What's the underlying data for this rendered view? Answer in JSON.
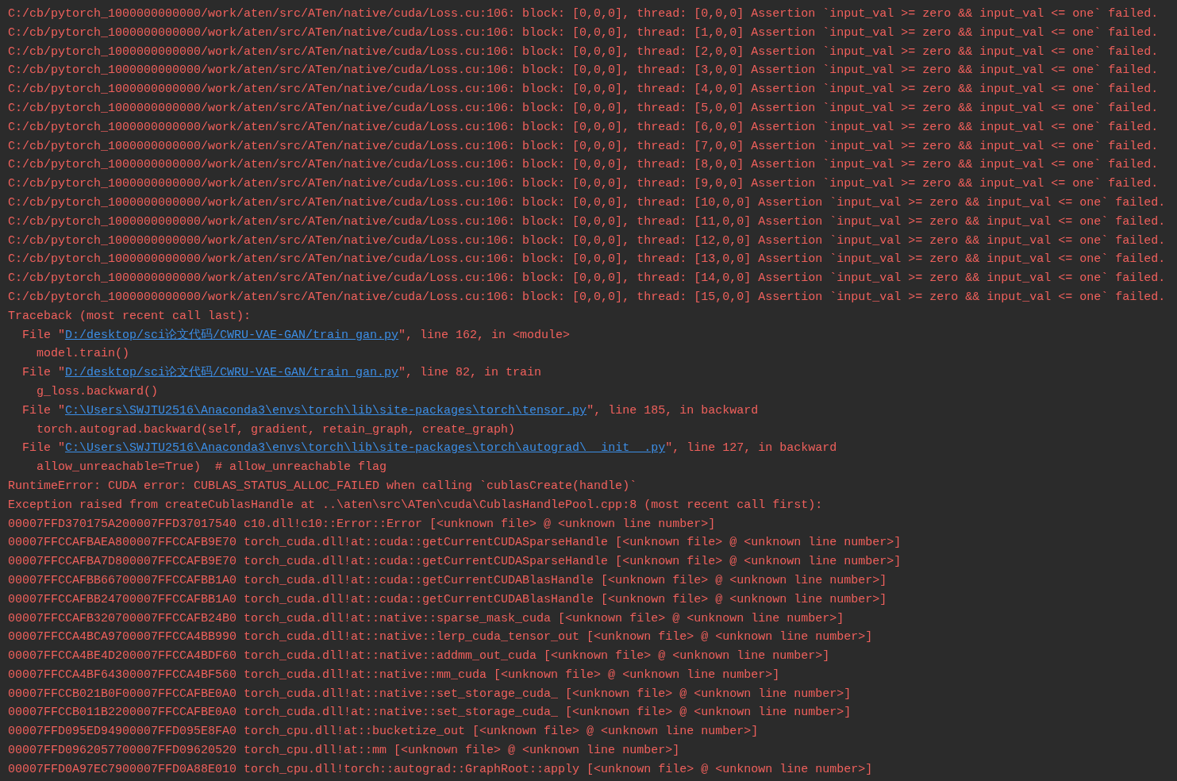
{
  "console": {
    "lines": [
      {
        "kind": "text",
        "text": "C:/cb/pytorch_1000000000000/work/aten/src/ATen/native/cuda/Loss.cu:106: block: [0,0,0], thread: [0,0,0] Assertion `input_val >= zero && input_val <= one` failed."
      },
      {
        "kind": "text",
        "text": "C:/cb/pytorch_1000000000000/work/aten/src/ATen/native/cuda/Loss.cu:106: block: [0,0,0], thread: [1,0,0] Assertion `input_val >= zero && input_val <= one` failed."
      },
      {
        "kind": "text",
        "text": "C:/cb/pytorch_1000000000000/work/aten/src/ATen/native/cuda/Loss.cu:106: block: [0,0,0], thread: [2,0,0] Assertion `input_val >= zero && input_val <= one` failed."
      },
      {
        "kind": "text",
        "text": "C:/cb/pytorch_1000000000000/work/aten/src/ATen/native/cuda/Loss.cu:106: block: [0,0,0], thread: [3,0,0] Assertion `input_val >= zero && input_val <= one` failed."
      },
      {
        "kind": "text",
        "text": "C:/cb/pytorch_1000000000000/work/aten/src/ATen/native/cuda/Loss.cu:106: block: [0,0,0], thread: [4,0,0] Assertion `input_val >= zero && input_val <= one` failed."
      },
      {
        "kind": "text",
        "text": "C:/cb/pytorch_1000000000000/work/aten/src/ATen/native/cuda/Loss.cu:106: block: [0,0,0], thread: [5,0,0] Assertion `input_val >= zero && input_val <= one` failed."
      },
      {
        "kind": "text",
        "text": "C:/cb/pytorch_1000000000000/work/aten/src/ATen/native/cuda/Loss.cu:106: block: [0,0,0], thread: [6,0,0] Assertion `input_val >= zero && input_val <= one` failed."
      },
      {
        "kind": "text",
        "text": "C:/cb/pytorch_1000000000000/work/aten/src/ATen/native/cuda/Loss.cu:106: block: [0,0,0], thread: [7,0,0] Assertion `input_val >= zero && input_val <= one` failed."
      },
      {
        "kind": "text",
        "text": "C:/cb/pytorch_1000000000000/work/aten/src/ATen/native/cuda/Loss.cu:106: block: [0,0,0], thread: [8,0,0] Assertion `input_val >= zero && input_val <= one` failed."
      },
      {
        "kind": "text",
        "text": "C:/cb/pytorch_1000000000000/work/aten/src/ATen/native/cuda/Loss.cu:106: block: [0,0,0], thread: [9,0,0] Assertion `input_val >= zero && input_val <= one` failed."
      },
      {
        "kind": "text",
        "text": "C:/cb/pytorch_1000000000000/work/aten/src/ATen/native/cuda/Loss.cu:106: block: [0,0,0], thread: [10,0,0] Assertion `input_val >= zero && input_val <= one` failed."
      },
      {
        "kind": "text",
        "text": "C:/cb/pytorch_1000000000000/work/aten/src/ATen/native/cuda/Loss.cu:106: block: [0,0,0], thread: [11,0,0] Assertion `input_val >= zero && input_val <= one` failed."
      },
      {
        "kind": "text",
        "text": "C:/cb/pytorch_1000000000000/work/aten/src/ATen/native/cuda/Loss.cu:106: block: [0,0,0], thread: [12,0,0] Assertion `input_val >= zero && input_val <= one` failed."
      },
      {
        "kind": "text",
        "text": "C:/cb/pytorch_1000000000000/work/aten/src/ATen/native/cuda/Loss.cu:106: block: [0,0,0], thread: [13,0,0] Assertion `input_val >= zero && input_val <= one` failed."
      },
      {
        "kind": "text",
        "text": "C:/cb/pytorch_1000000000000/work/aten/src/ATen/native/cuda/Loss.cu:106: block: [0,0,0], thread: [14,0,0] Assertion `input_val >= zero && input_val <= one` failed."
      },
      {
        "kind": "text",
        "text": "C:/cb/pytorch_1000000000000/work/aten/src/ATen/native/cuda/Loss.cu:106: block: [0,0,0], thread: [15,0,0] Assertion `input_val >= zero && input_val <= one` failed."
      },
      {
        "kind": "text",
        "text": "Traceback (most recent call last):"
      },
      {
        "kind": "file",
        "prefix": "  File \"",
        "path": "D:/desktop/sci论文代码/CWRU-VAE-GAN/train_gan.py",
        "suffix": "\", line 162, in <module>"
      },
      {
        "kind": "text",
        "text": "    model.train()"
      },
      {
        "kind": "file",
        "prefix": "  File \"",
        "path": "D:/desktop/sci论文代码/CWRU-VAE-GAN/train_gan.py",
        "suffix": "\", line 82, in train"
      },
      {
        "kind": "text",
        "text": "    g_loss.backward()"
      },
      {
        "kind": "file",
        "prefix": "  File \"",
        "path": "C:\\Users\\SWJTU2516\\Anaconda3\\envs\\torch\\lib\\site-packages\\torch\\tensor.py",
        "suffix": "\", line 185, in backward"
      },
      {
        "kind": "text",
        "text": "    torch.autograd.backward(self, gradient, retain_graph, create_graph)"
      },
      {
        "kind": "file",
        "prefix": "  File \"",
        "path": "C:\\Users\\SWJTU2516\\Anaconda3\\envs\\torch\\lib\\site-packages\\torch\\autograd\\__init__.py",
        "suffix": "\", line 127, in backward"
      },
      {
        "kind": "text",
        "text": "    allow_unreachable=True)  # allow_unreachable flag"
      },
      {
        "kind": "text",
        "text": "RuntimeError: CUDA error: CUBLAS_STATUS_ALLOC_FAILED when calling `cublasCreate(handle)`"
      },
      {
        "kind": "text",
        "text": "Exception raised from createCublasHandle at ..\\aten\\src\\ATen\\cuda\\CublasHandlePool.cpp:8 (most recent call first):"
      },
      {
        "kind": "text",
        "text": "00007FFD370175A200007FFD37017540 c10.dll!c10::Error::Error [<unknown file> @ <unknown line number>]"
      },
      {
        "kind": "text",
        "text": "00007FFCCAFBAEA800007FFCCAFB9E70 torch_cuda.dll!at::cuda::getCurrentCUDASparseHandle [<unknown file> @ <unknown line number>]"
      },
      {
        "kind": "text",
        "text": "00007FFCCAFBA7D800007FFCCAFB9E70 torch_cuda.dll!at::cuda::getCurrentCUDASparseHandle [<unknown file> @ <unknown line number>]"
      },
      {
        "kind": "text",
        "text": "00007FFCCAFBB66700007FFCCAFBB1A0 torch_cuda.dll!at::cuda::getCurrentCUDABlasHandle [<unknown file> @ <unknown line number>]"
      },
      {
        "kind": "text",
        "text": "00007FFCCAFBB24700007FFCCAFBB1A0 torch_cuda.dll!at::cuda::getCurrentCUDABlasHandle [<unknown file> @ <unknown line number>]"
      },
      {
        "kind": "text",
        "text": "00007FFCCAFB320700007FFCCAFB24B0 torch_cuda.dll!at::native::sparse_mask_cuda [<unknown file> @ <unknown line number>]"
      },
      {
        "kind": "text",
        "text": "00007FFCCA4BCA9700007FFCCA4BB990 torch_cuda.dll!at::native::lerp_cuda_tensor_out [<unknown file> @ <unknown line number>]"
      },
      {
        "kind": "text",
        "text": "00007FFCCA4BE4D200007FFCCA4BDF60 torch_cuda.dll!at::native::addmm_out_cuda [<unknown file> @ <unknown line number>]"
      },
      {
        "kind": "text",
        "text": "00007FFCCA4BF64300007FFCCA4BF560 torch_cuda.dll!at::native::mm_cuda [<unknown file> @ <unknown line number>]"
      },
      {
        "kind": "text",
        "text": "00007FFCCB021B0F00007FFCCAFBE0A0 torch_cuda.dll!at::native::set_storage_cuda_ [<unknown file> @ <unknown line number>]"
      },
      {
        "kind": "text",
        "text": "00007FFCCB011B2200007FFCCAFBE0A0 torch_cuda.dll!at::native::set_storage_cuda_ [<unknown file> @ <unknown line number>]"
      },
      {
        "kind": "text",
        "text": "00007FFD095ED94900007FFD095E8FA0 torch_cpu.dll!at::bucketize_out [<unknown file> @ <unknown line number>]"
      },
      {
        "kind": "text",
        "text": "00007FFD0962057700007FFD09620520 torch_cpu.dll!at::mm [<unknown file> @ <unknown line number>]"
      },
      {
        "kind": "text",
        "text": "00007FFD0A97EC7900007FFD0A88E010 torch_cpu.dll!torch::autograd::GraphRoot::apply [<unknown file> @ <unknown line number>]"
      }
    ]
  }
}
